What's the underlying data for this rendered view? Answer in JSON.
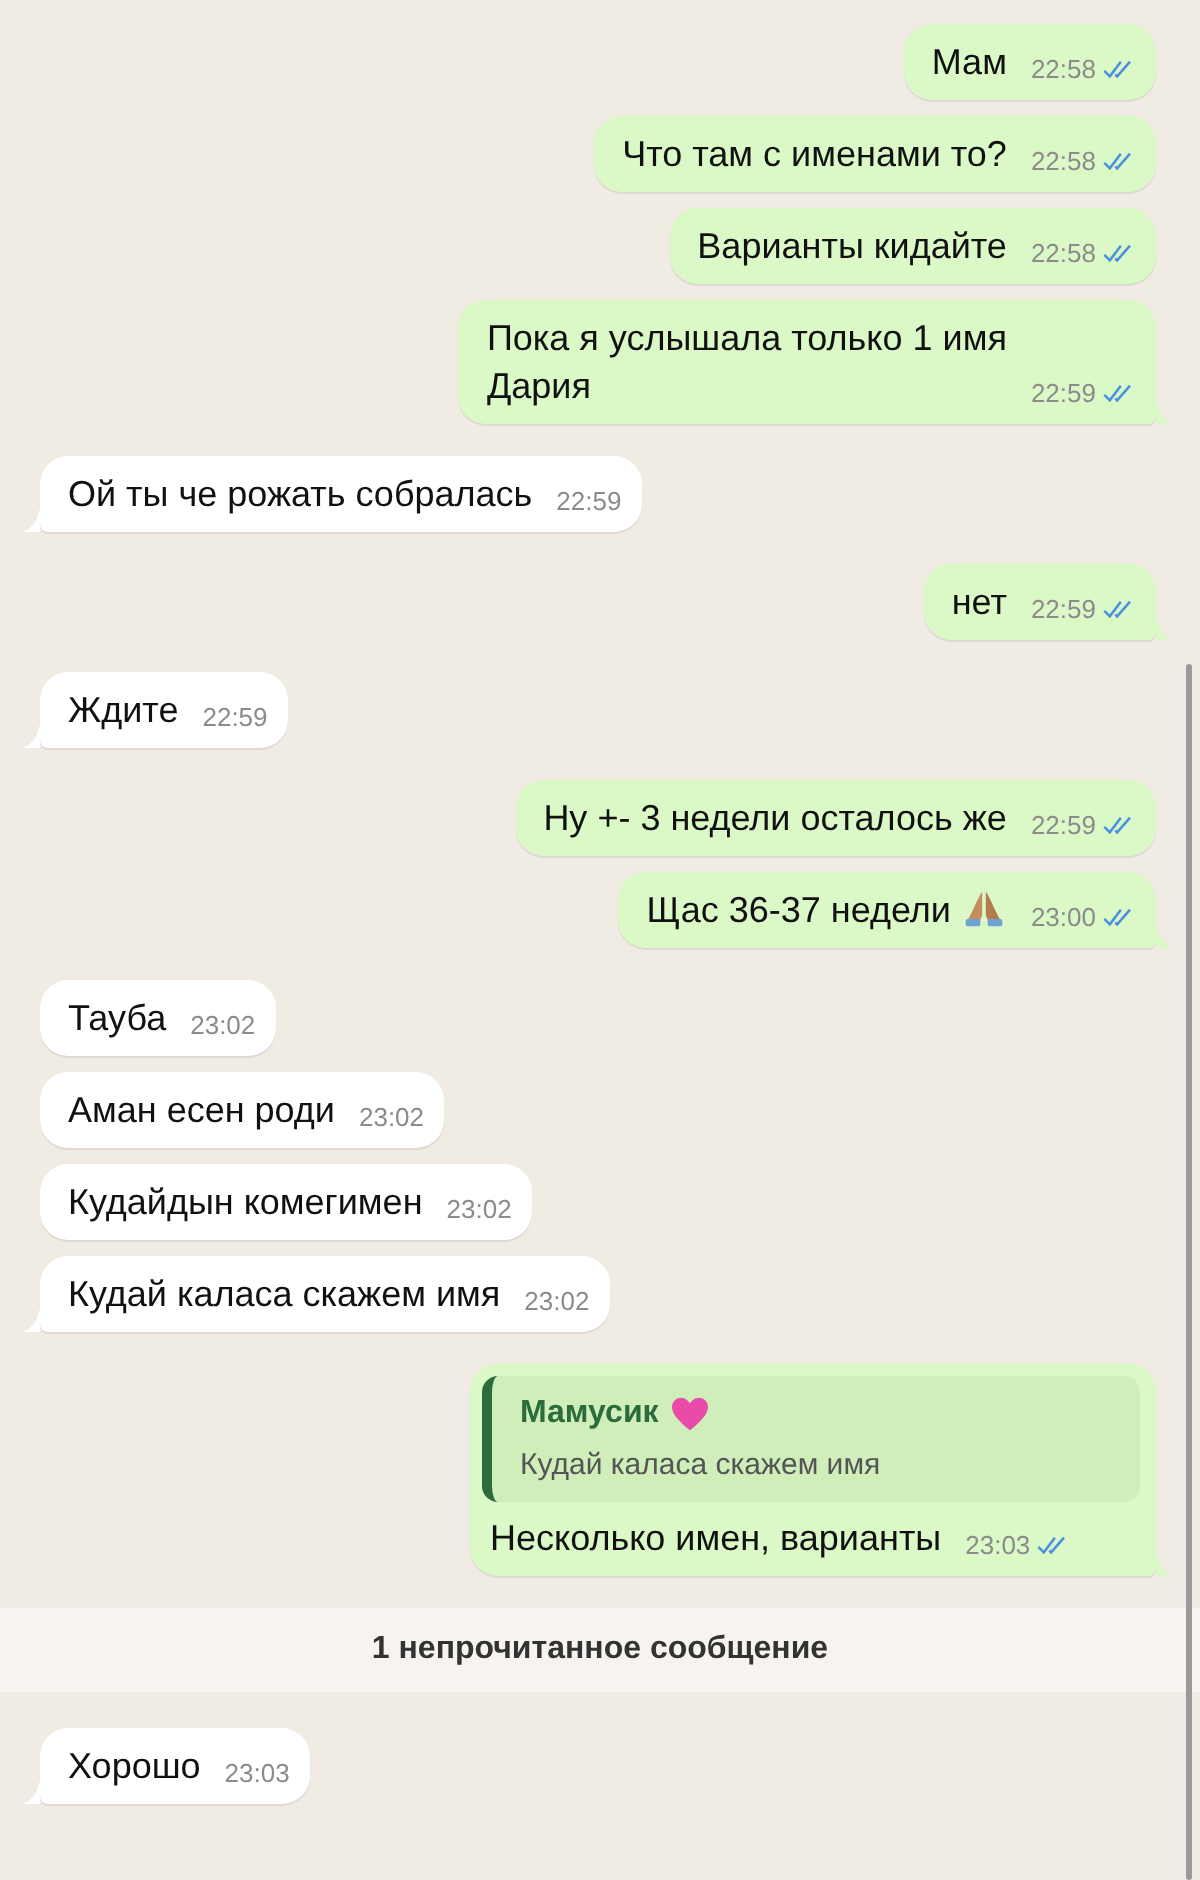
{
  "messages": [
    {
      "kind": "message",
      "outgoing": true,
      "text": "Мам",
      "time": "22:58",
      "read": true,
      "tail": false
    },
    {
      "kind": "message",
      "outgoing": true,
      "text": "Что там с именами то?",
      "time": "22:58",
      "read": true,
      "tail": false
    },
    {
      "kind": "message",
      "outgoing": true,
      "text": "Варианты кидайте",
      "time": "22:58",
      "read": true,
      "tail": false
    },
    {
      "kind": "message",
      "outgoing": true,
      "text": "Пока я услышала только 1 имя\nДария",
      "time": "22:59",
      "read": true,
      "tail": true
    },
    {
      "kind": "message",
      "outgoing": false,
      "text": "Ой ты че рожать собралась",
      "time": "22:59",
      "tail": true
    },
    {
      "kind": "message",
      "outgoing": true,
      "text": "нет",
      "time": "22:59",
      "read": true,
      "tail": true
    },
    {
      "kind": "message",
      "outgoing": false,
      "text": "Ждите",
      "time": "22:59",
      "tail": true
    },
    {
      "kind": "message",
      "outgoing": true,
      "text": "Ну +- 3 недели осталось же",
      "time": "22:59",
      "read": true,
      "tail": false
    },
    {
      "kind": "message",
      "outgoing": true,
      "text": "Щас 36-37 недели",
      "emoji": {
        "kind": "pray"
      },
      "time": "23:00",
      "read": true,
      "tail": true
    },
    {
      "kind": "message",
      "outgoing": false,
      "text": "Тауба",
      "time": "23:02",
      "tail": false
    },
    {
      "kind": "message",
      "outgoing": false,
      "text": "Аман есен роди",
      "time": "23:02",
      "tail": false
    },
    {
      "kind": "message",
      "outgoing": false,
      "text": "Кудайдын комегимен",
      "time": "23:02",
      "tail": false
    },
    {
      "kind": "message",
      "outgoing": false,
      "text": "Кудай каласа скажем имя",
      "time": "23:02",
      "tail": true
    },
    {
      "kind": "message",
      "outgoing": true,
      "reply": {
        "author": "Мамусик",
        "emoji": {
          "kind": "heart"
        },
        "text": "Кудай каласа скажем имя"
      },
      "text": "Несколько имен, варианты",
      "time": "23:03",
      "read": true,
      "tail": true
    },
    {
      "kind": "divider",
      "text": "1 непрочитанное сообщение"
    },
    {
      "kind": "message",
      "outgoing": false,
      "text": "Хорошо",
      "time": "23:03",
      "tail": true
    }
  ]
}
